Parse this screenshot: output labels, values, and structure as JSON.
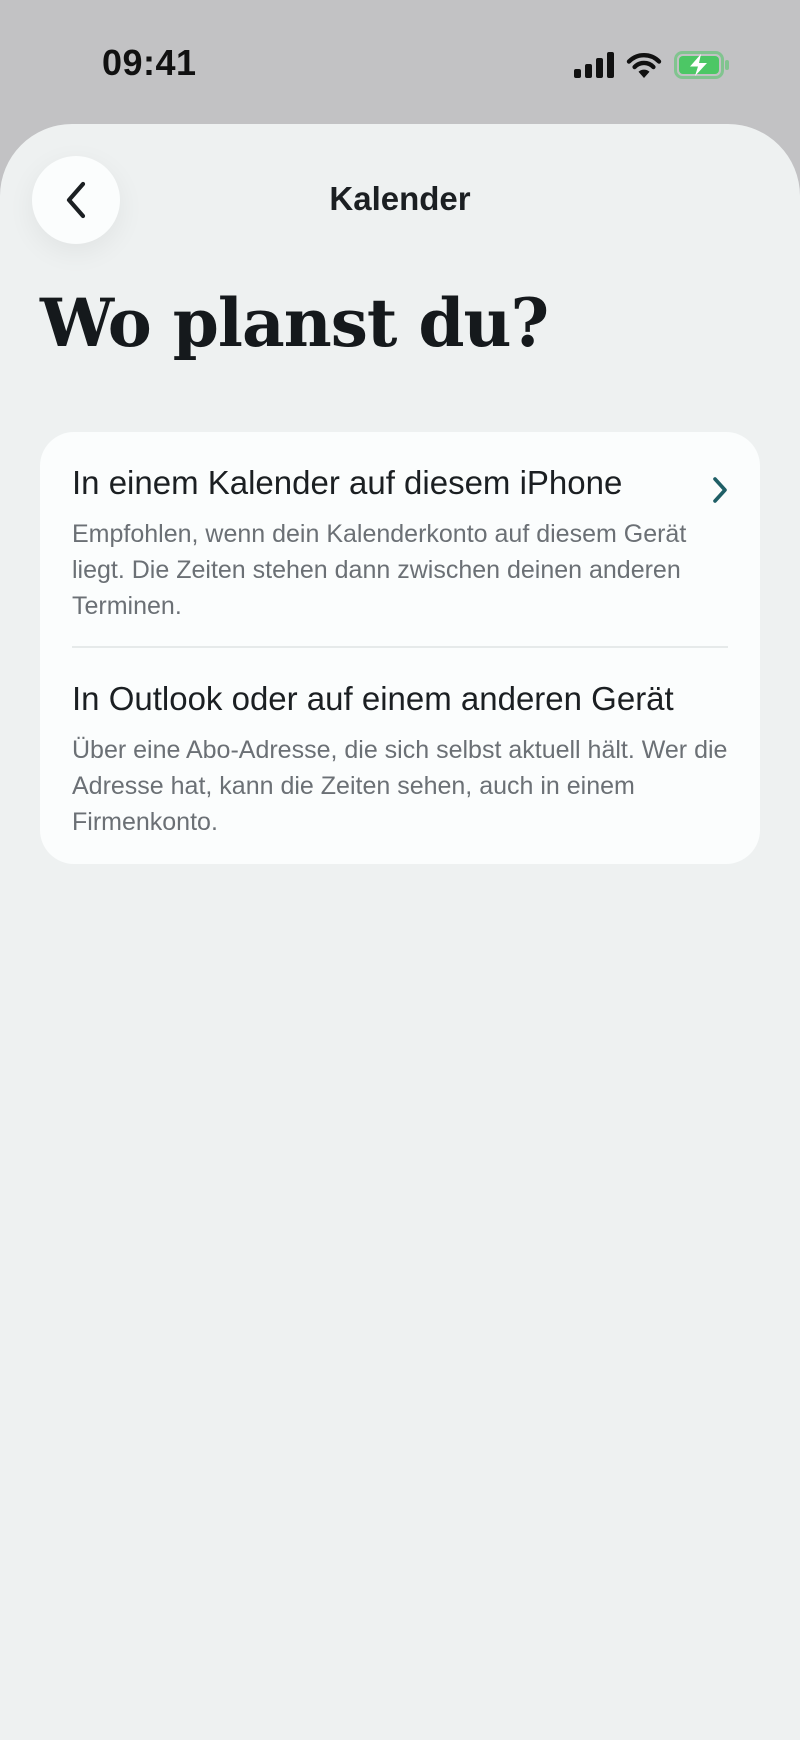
{
  "status_bar": {
    "time": "09:41"
  },
  "header": {
    "title": "Kalender"
  },
  "page": {
    "title": "Wo planst du?"
  },
  "options": [
    {
      "title": "In einem Kalender auf diesem iPhone",
      "description": "Empfohlen, wenn dein Kalenderkonto auf diesem Gerät liegt. Die Zeiten stehen dann zwischen deinen anderen Terminen."
    },
    {
      "title": "In Outlook oder auf einem anderen Gerät",
      "description": "Über eine Abo-Adresse, die sich selbst aktuell hält. Wer die Adresse hat, kann die Zeiten sehen, auch in einem Firmenkonto."
    }
  ],
  "colors": {
    "accent": "#1f5f66",
    "battery": "#4cc765",
    "sheet_background": "#eef1f1",
    "card_background": "#fbfdfd"
  },
  "icons": {
    "back": "chevron-left-icon",
    "option_arrow": "chevron-right-icon",
    "signal": "cellular-signal-icon",
    "wifi": "wifi-icon",
    "battery": "battery-charging-icon"
  }
}
